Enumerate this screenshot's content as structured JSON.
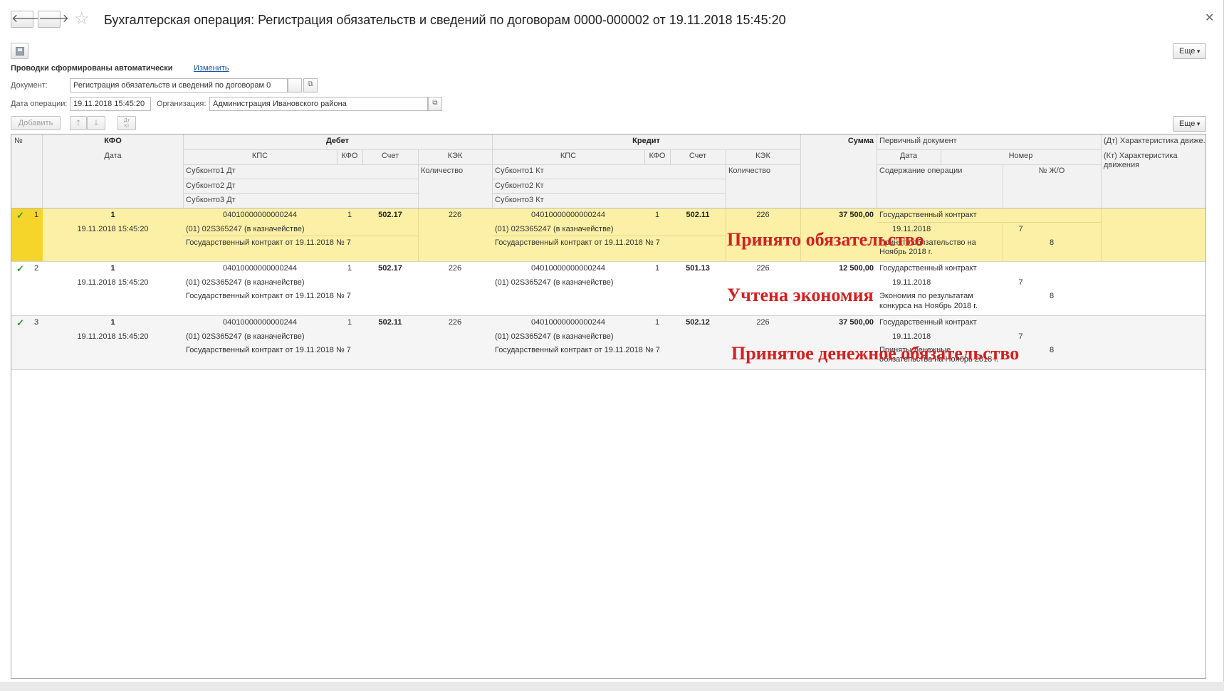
{
  "window": {
    "title": "Бухгалтерская операция: Регистрация обязательств и сведений по договорам 0000-000002 от 19.11.2018 15:45:20",
    "more_label": "Еще"
  },
  "header": {
    "auto_postings": "Проводки сформированы автоматически",
    "change_link": "Изменить",
    "document_label": "Документ:",
    "document_value": "Регистрация обязательств и сведений по договорам 0",
    "date_label": "Дата операции:",
    "date_value": "19.11.2018 15:45:20",
    "org_label": "Организация:",
    "org_value": "Администрация Ивановского района",
    "select_glyph": "...",
    "open_glyph": "⧉"
  },
  "toolbar": {
    "add_label": "Добавить",
    "more_label": "Еще",
    "dtkt_top": "Дт",
    "dtkt_bottom": "Кт"
  },
  "table": {
    "headers": {
      "num": "№",
      "kfo": "КФО",
      "date": "Дата",
      "debit": "Дебет",
      "credit": "Кредит",
      "kps": "КПС",
      "kfo_small": "КФО",
      "account": "Счет",
      "kek": "КЭК",
      "qty": "Количество",
      "sub1_dt": "Субконто1 Дт",
      "sub2_dt": "Субконто2 Дт",
      "sub3_dt": "Субконто3 Дт",
      "sub1_kt": "Субконто1 Кт",
      "sub2_kt": "Субконто2 Кт",
      "sub3_kt": "Субконто3 Кт",
      "sum": "Сумма",
      "primary_doc": "Первичный документ",
      "pd_date": "Дата",
      "pd_number": "Номер",
      "op_content": "Содержание операции",
      "journal_no": "№ Ж/О",
      "dt_char": "(Дт) Характеристика движе...",
      "kt_char_1": "(Кт) Характеристика",
      "kt_char_2": "движения"
    },
    "rows": [
      {
        "num": "1",
        "kfo": "1",
        "date": "19.11.2018 15:45:20",
        "dt_kps": "04010000000000244",
        "dt_kfo": "1",
        "dt_account": "502.17",
        "dt_kek": "226",
        "dt_sub1": "(01) 02S365247 (в казначействе)",
        "dt_sub2": "Государственный контракт от 19.11.2018 № 7",
        "kt_kps": "04010000000000244",
        "kt_kfo": "1",
        "kt_account": "502.11",
        "kt_kek": "226",
        "kt_sub1": "(01) 02S365247 (в казначействе)",
        "kt_sub2": "Государственный контракт от 19.11.2018 № 7",
        "sum": "37 500,00",
        "pd_name": "Государственный контракт",
        "pd_date": "19.11.2018",
        "pd_number": "7",
        "content_1": "Принято обязательство на",
        "content_2": "Ноябрь 2018 г.",
        "journal": "8"
      },
      {
        "num": "2",
        "kfo": "1",
        "date": "19.11.2018 15:45:20",
        "dt_kps": "04010000000000244",
        "dt_kfo": "1",
        "dt_account": "502.17",
        "dt_kek": "226",
        "dt_sub1": "(01) 02S365247 (в казначействе)",
        "dt_sub2": "Государственный контракт от 19.11.2018 № 7",
        "kt_kps": "04010000000000244",
        "kt_kfo": "1",
        "kt_account": "501.13",
        "kt_kek": "226",
        "kt_sub1": "(01) 02S365247 (в казначействе)",
        "kt_sub2": "",
        "sum": "12 500,00",
        "pd_name": "Государственный контракт",
        "pd_date": "19.11.2018",
        "pd_number": "7",
        "content_1": "Экономия по результатам",
        "content_2": "конкурса на Ноябрь 2018 г.",
        "journal": "8"
      },
      {
        "num": "3",
        "kfo": "1",
        "date": "19.11.2018 15:45:20",
        "dt_kps": "04010000000000244",
        "dt_kfo": "1",
        "dt_account": "502.11",
        "dt_kek": "226",
        "dt_sub1": "(01) 02S365247 (в казначействе)",
        "dt_sub2": "Государственный контракт от 19.11.2018 № 7",
        "kt_kps": "04010000000000244",
        "kt_kfo": "1",
        "kt_account": "502.12",
        "kt_kek": "226",
        "kt_sub1": "(01) 02S365247 (в казначействе)",
        "kt_sub2": "Государственный контракт от 19.11.2018 № 7",
        "sum": "37 500,00",
        "pd_name": "Государственный контракт",
        "pd_date": "19.11.2018",
        "pd_number": "7",
        "content_1": "Приняты денежные",
        "content_2": "обязательства на Ноябрь 2018 г.",
        "journal": "8"
      }
    ]
  },
  "annotations": {
    "a1": "Принято обязательство",
    "a2": "Учтена экономия",
    "a3": "Принятое денежное обязательство"
  },
  "icons": {
    "back": "arrow-left-icon",
    "forward": "arrow-right-icon",
    "star": "star-icon",
    "close": "close-icon",
    "save": "save-icon",
    "check": "check-icon"
  },
  "colors": {
    "selected_row": "#fcf0a6",
    "selected_marker": "#f5d52a",
    "annotation": "#d61f1f",
    "link": "#1a55a8",
    "check": "#2d9a2d"
  }
}
